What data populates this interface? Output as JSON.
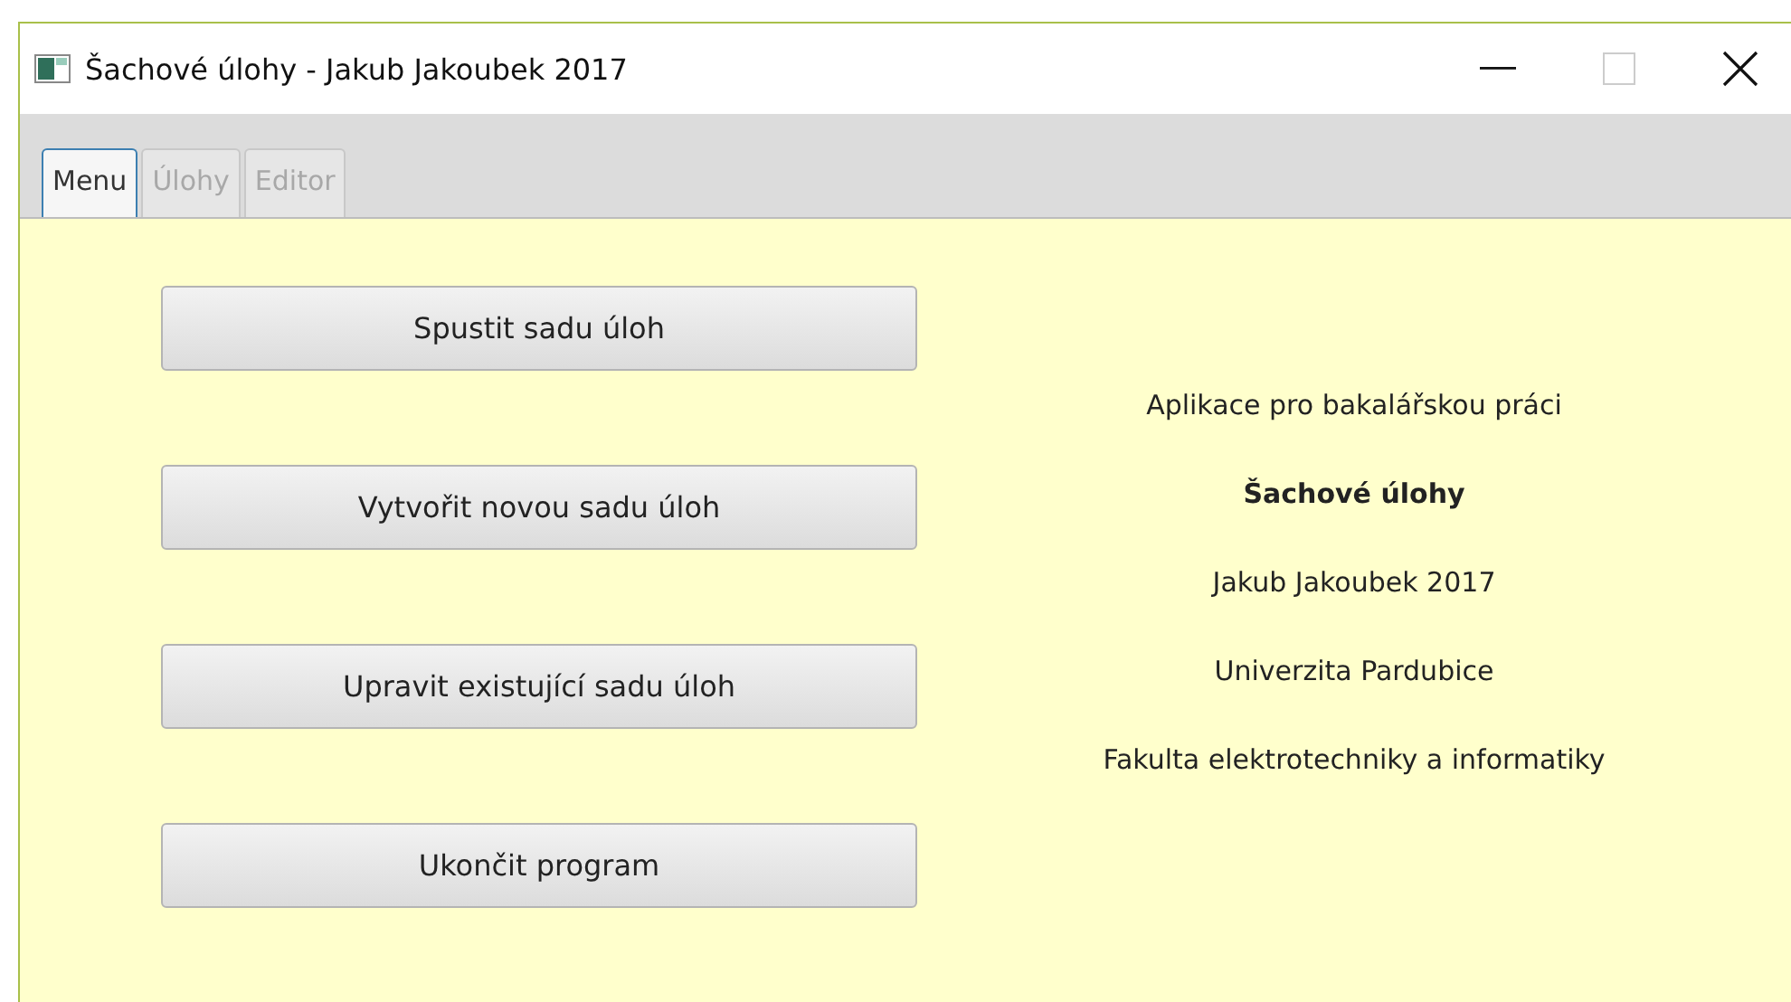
{
  "window": {
    "title": "Šachové úlohy - Jakub Jakoubek 2017",
    "maximize_disabled": true
  },
  "tabs": [
    {
      "label": "Menu",
      "selected": true,
      "disabled": false
    },
    {
      "label": "Úlohy",
      "selected": false,
      "disabled": true
    },
    {
      "label": "Editor",
      "selected": false,
      "disabled": true
    }
  ],
  "buttons": [
    "Spustit sadu úloh",
    "Vytvořit novou sadu úloh",
    "Upravit existující sadu úloh",
    "Ukončit program"
  ],
  "info": [
    {
      "kind": "text",
      "text": "Aplikace pro bakalářskou práci"
    },
    {
      "kind": "title",
      "text": "Šachové úlohy"
    },
    {
      "kind": "text",
      "text": "Jakub Jakoubek 2017"
    },
    {
      "kind": "text",
      "text": "Univerzita Pardubice"
    },
    {
      "kind": "text",
      "text": "Fakulta elektrotechniky a informatiky"
    }
  ]
}
